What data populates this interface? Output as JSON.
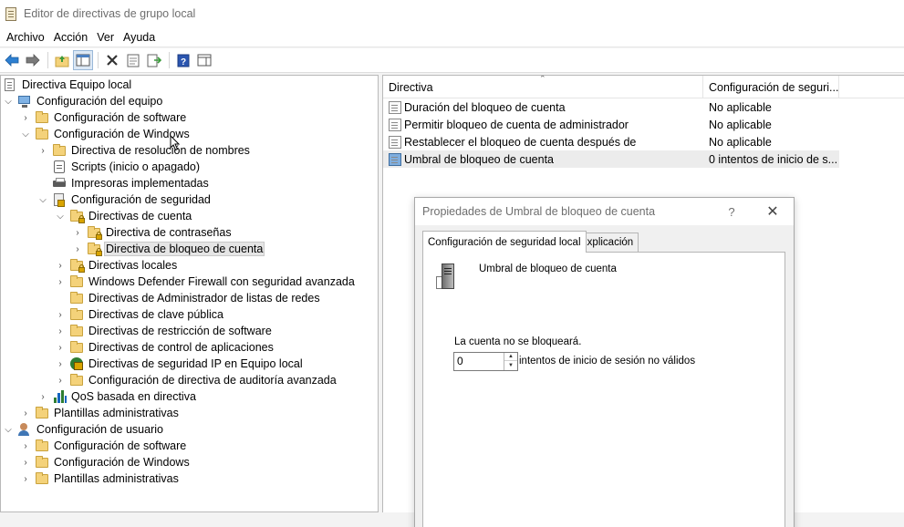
{
  "window": {
    "title": "Editor de directivas de grupo local"
  },
  "menu": [
    "Archivo",
    "Acción",
    "Ver",
    "Ayuda"
  ],
  "toolbar": {
    "icons": [
      "back-arrow-icon",
      "forward-arrow-icon",
      "up-folder-icon",
      "show-hide-tree-icon",
      "delete-icon",
      "properties-icon",
      "export-list-icon",
      "help-icon",
      "action-pane-icon"
    ]
  },
  "tree": {
    "root": "Directiva Equipo local",
    "computer_config": "Configuración del equipo",
    "cc_software": "Configuración de software",
    "cc_windows": "Configuración de Windows",
    "name_resolution": "Directiva de resolución de nombres",
    "scripts": "Scripts (inicio o apagado)",
    "printers": "Impresoras implementadas",
    "security_config": "Configuración de seguridad",
    "account_policies": "Directivas de cuenta",
    "password_policy": "Directiva de contraseñas",
    "lockout_policy": "Directiva de bloqueo de cuenta",
    "local_policies": "Directivas locales",
    "defender_firewall": "Windows Defender Firewall con seguridad avanzada",
    "network_list": "Directivas de Administrador de listas de redes",
    "public_key": "Directivas de clave pública",
    "software_restriction": "Directivas de restricción de software",
    "app_control": "Directivas de control de aplicaciones",
    "ipsec": "Directivas de seguridad IP en Equipo local",
    "audit_config": "Configuración de directiva de auditoría avanzada",
    "qos": "QoS basada en directiva",
    "cc_admin_templates": "Plantillas administrativas",
    "user_config": "Configuración de usuario",
    "uc_software": "Configuración de software",
    "uc_windows": "Configuración de Windows",
    "uc_admin_templates": "Plantillas administrativas"
  },
  "list": {
    "col_policy": "Directiva",
    "col_setting": "Configuración de seguri...",
    "rows": [
      {
        "name": "Duración del bloqueo de cuenta",
        "value": "No aplicable"
      },
      {
        "name": "Permitir bloqueo de cuenta de administrador",
        "value": "No aplicable"
      },
      {
        "name": "Restablecer el bloqueo de cuenta después de",
        "value": "No aplicable"
      },
      {
        "name": "Umbral de bloqueo de cuenta",
        "value": "0 intentos de inicio de s..."
      }
    ]
  },
  "dialog": {
    "title": "Propiedades de Umbral de bloqueo de cuenta",
    "help": "?",
    "close": "✕",
    "tab_local": "Configuración de seguridad local",
    "tab_explain": "Explicación",
    "setting_name": "Umbral de bloqueo de cuenta",
    "account_label": "La cuenta no se bloqueará.",
    "threshold_value": "0",
    "suffix": "intentos de inicio de sesión no válidos"
  }
}
